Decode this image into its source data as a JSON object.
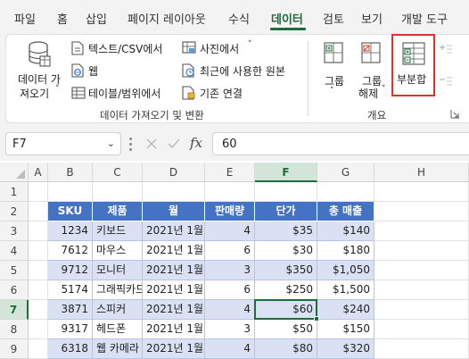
{
  "tabs": [
    "파일",
    "홈",
    "삽입",
    "페이지 레이아웃",
    "수식",
    "데이터",
    "검토",
    "보기",
    "개발 도구"
  ],
  "active_tab": "데이터",
  "ribbon": {
    "get_data_line1": "데이터 가",
    "get_data_line2": "져오기",
    "from_text_csv": "텍스트/CSV에서",
    "from_web": "웹",
    "from_table_range": "테이블/범위에서",
    "from_picture": "사진에서",
    "recent_sources": "최근에 사용한 원본",
    "existing_connections": "기존 연결",
    "group_get_transform": "데이터 가져오기 및 변환",
    "group_btn": "그룹",
    "ungroup_line1": "그룹",
    "ungroup_line2": "해제",
    "subtotal": "부분합",
    "group_outline": "개요"
  },
  "namebox": "F7",
  "formula_value": "60",
  "fx_label": "fx",
  "columns": [
    "A",
    "B",
    "C",
    "D",
    "E",
    "F",
    "G",
    "H"
  ],
  "selected_column": "F",
  "rows": [
    "1",
    "2",
    "3",
    "4",
    "5",
    "6",
    "7",
    "8",
    "9"
  ],
  "selected_row": "7",
  "table": {
    "headers": [
      "SKU",
      "제품",
      "월",
      "판매량",
      "단가",
      "총 매출"
    ],
    "rows": [
      [
        "1234",
        "키보드",
        "2021년 1월",
        "4",
        "$35",
        "$140"
      ],
      [
        "7612",
        "마우스",
        "2021년 1월",
        "6",
        "$30",
        "$180"
      ],
      [
        "9712",
        "모니터",
        "2021년 1월",
        "3",
        "$350",
        "$1,050"
      ],
      [
        "5174",
        "그래픽카드",
        "2021년 1월",
        "6",
        "$250",
        "$1,500"
      ],
      [
        "3871",
        "스피커",
        "2021년 1월",
        "4",
        "$60",
        "$240"
      ],
      [
        "9317",
        "헤드폰",
        "2021년 1월",
        "3",
        "$50",
        "$150"
      ],
      [
        "6318",
        "웹 카메라",
        "2021년 1월",
        "4",
        "$80",
        "$320"
      ]
    ]
  },
  "colors": {
    "accent_green": "#1e6b3c",
    "table_header": "#4472c4",
    "table_band": "#d9e1f2",
    "highlight_box": "#e0312b"
  }
}
